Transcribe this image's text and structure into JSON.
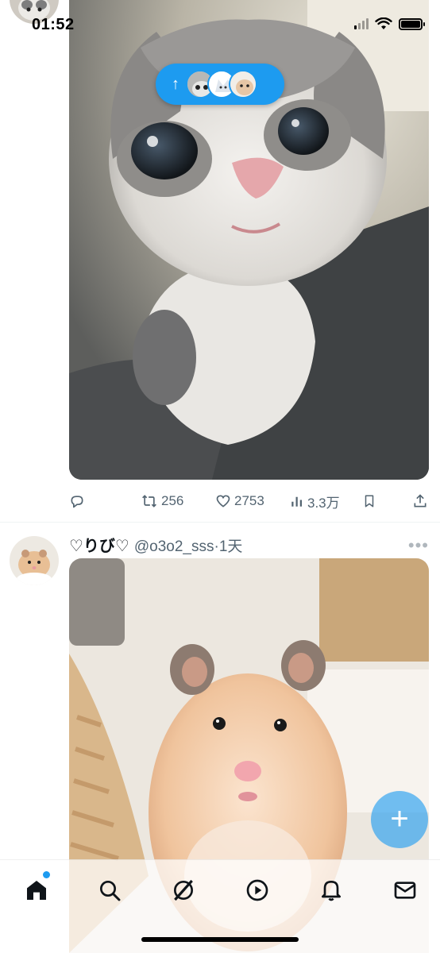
{
  "status_bar": {
    "time": "01:52"
  },
  "new_posts_pill": {
    "arrow": "↑"
  },
  "tweet1": {
    "actions": {
      "reply_count": "",
      "retweet_count": "256",
      "like_count": "2753",
      "views_count": "3.3万"
    }
  },
  "tweet2": {
    "display_name": "♡りび♡",
    "handle": "@o3o2_sss",
    "separator": "·",
    "time_ago": "1天",
    "more": "•••"
  },
  "fab": {
    "label": "+"
  },
  "icons": {
    "reply": "reply-icon",
    "retweet": "retweet-icon",
    "like": "heart-icon",
    "views": "views-icon",
    "bookmark": "bookmark-icon",
    "share": "share-icon",
    "home": "home-icon",
    "search": "search-icon",
    "grok": "grok-icon",
    "video": "video-icon",
    "notifications": "bell-icon",
    "messages": "mail-icon"
  },
  "colors": {
    "accent": "#1d9bf0",
    "muted": "#536471",
    "text": "#0f1419"
  }
}
